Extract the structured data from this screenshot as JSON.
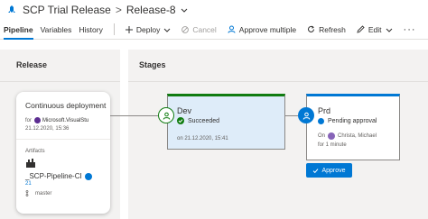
{
  "header": {
    "pipeline_name": "SCP Trial Release",
    "separator": ">",
    "release_name": "Release-8"
  },
  "tabs": [
    {
      "label": "Pipeline",
      "active": true
    },
    {
      "label": "Variables",
      "active": false
    },
    {
      "label": "History",
      "active": false
    }
  ],
  "toolbar": {
    "deploy": "Deploy",
    "cancel": "Cancel",
    "approve_multiple": "Approve multiple",
    "refresh": "Refresh",
    "edit": "Edit",
    "more": "···"
  },
  "release_panel": {
    "title": "Release",
    "card": {
      "title": "Continuous deployment",
      "for_label": "for",
      "for_name": "Microsoft.VisualStu",
      "date": "21.12.2020, 15:36",
      "artifacts_label": "Artifacts",
      "pipeline_name": "_SCP-Pipeline-CI",
      "build_number": "21",
      "branch": "master"
    }
  },
  "stages_panel": {
    "title": "Stages",
    "dev": {
      "name": "Dev",
      "status": "Succeeded",
      "date": "on 21.12.2020, 15:41"
    },
    "prd": {
      "name": "Prd",
      "status": "Pending approval",
      "on_label": "On",
      "approver": "Christa, Michael",
      "for_label": "for 1 minute",
      "approve_label": "Approve"
    }
  },
  "colors": {
    "accent": "#0078d4",
    "success": "#107c10",
    "panel_bg": "#f3f2f1",
    "dev_card_bg": "#deecf9"
  }
}
